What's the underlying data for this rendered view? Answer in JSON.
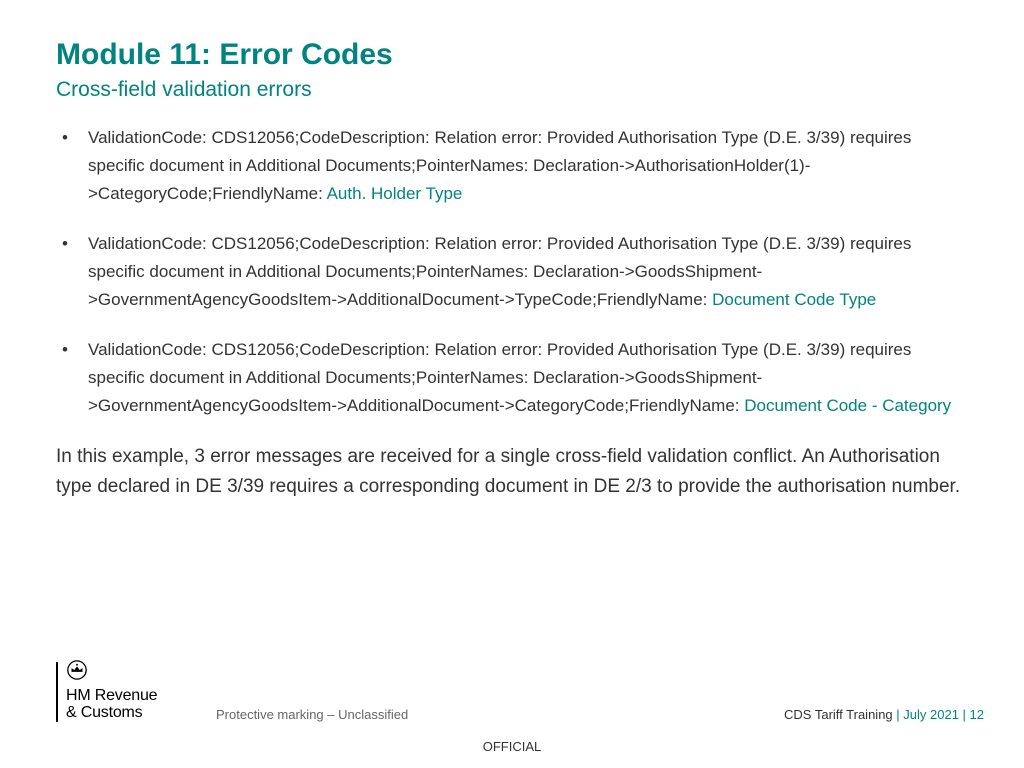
{
  "title": "Module 11: Error Codes",
  "subtitle": "Cross-field validation errors",
  "errors": [
    {
      "body": "ValidationCode: CDS12056;CodeDescription: Relation error: Provided Authorisation Type (D.E. 3/39) requires specific document in Additional Documents;PointerNames: Declaration->AuthorisationHolder(1)->CategoryCode;FriendlyName: ",
      "friendly": "Auth. Holder Type"
    },
    {
      "body": "ValidationCode: CDS12056;CodeDescription: Relation error: Provided Authorisation Type (D.E. 3/39) requires specific document in Additional Documents;PointerNames: Declaration->GoodsShipment->GovernmentAgencyGoodsItem->AdditionalDocument->TypeCode;FriendlyName: ",
      "friendly": "Document Code Type"
    },
    {
      "body": "ValidationCode: CDS12056;CodeDescription: Relation error: Provided Authorisation Type (D.E. 3/39) requires specific document in Additional Documents;PointerNames: Declaration->GoodsShipment->GovernmentAgencyGoodsItem->AdditionalDocument->CategoryCode;FriendlyName: ",
      "friendly": "Document Code - Category"
    }
  ],
  "explain": "In this example, 3 error messages are received for a single cross-field validation conflict. An Authorisation type declared in DE 3/39 requires a corresponding document in DE 2/3 to provide the authorisation number.",
  "org_line1": "HM Revenue",
  "org_line2": "& Customs",
  "protective": "Protective marking – Unclassified",
  "meta_course": "CDS Tariff Training",
  "meta_sep": "  |",
  "meta_date": " July 2021 ",
  "meta_sep2": "|  ",
  "meta_page": "12",
  "official": "OFFICIAL"
}
